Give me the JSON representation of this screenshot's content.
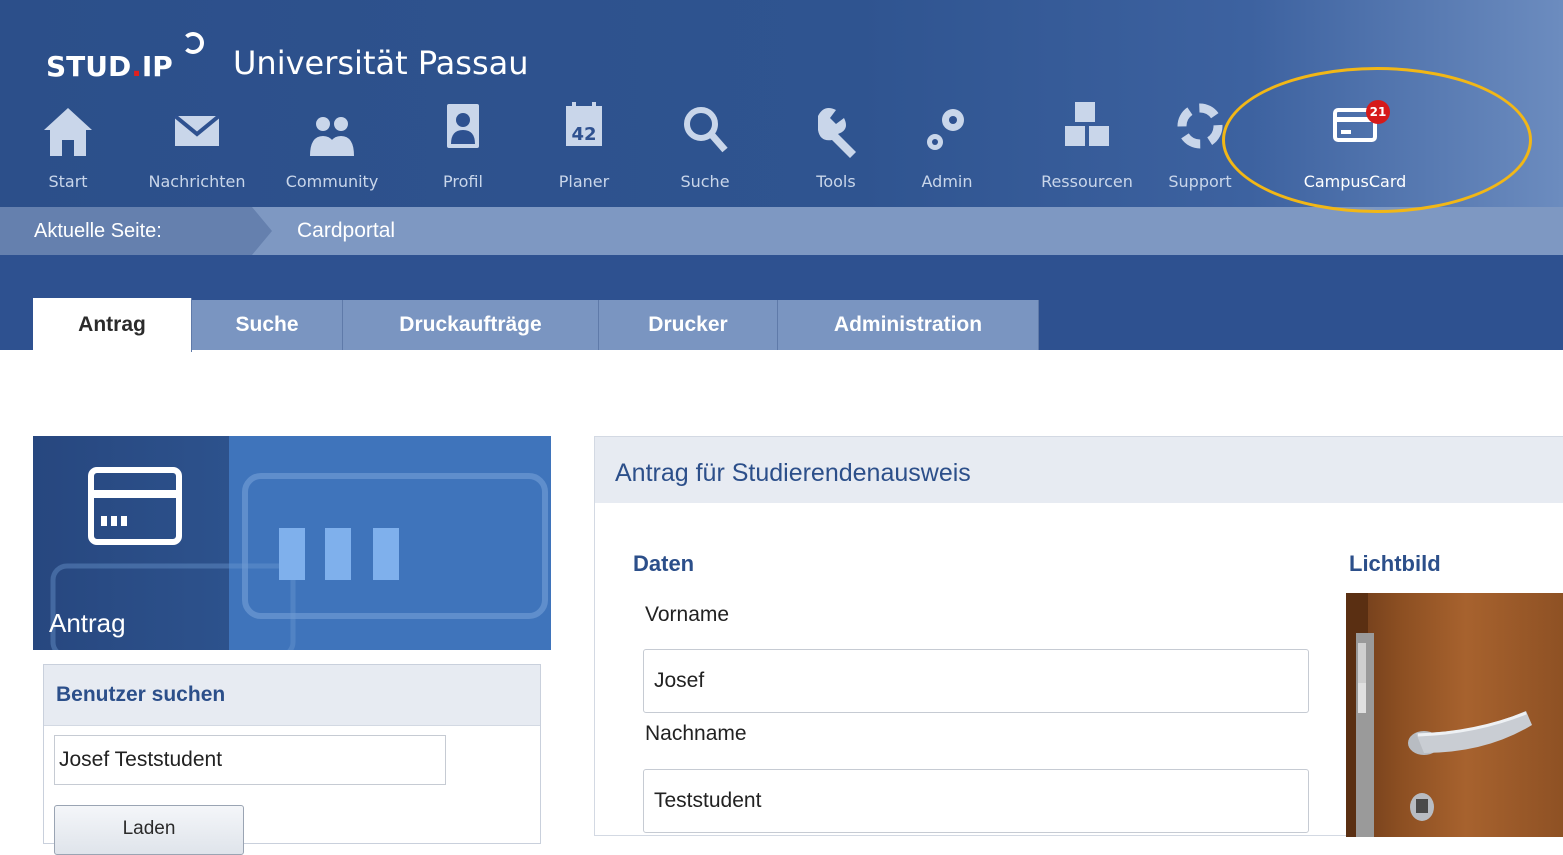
{
  "header": {
    "logo_text_a": "STUD",
    "logo_text_dot": ".",
    "logo_text_b": "IP",
    "institution": "Universität Passau",
    "nav": [
      {
        "label": "Start",
        "icon": "home-icon"
      },
      {
        "label": "Nachrichten",
        "icon": "envelope-icon"
      },
      {
        "label": "Community",
        "icon": "people-icon"
      },
      {
        "label": "Profil",
        "icon": "profile-icon"
      },
      {
        "label": "Planer",
        "icon": "calendar-icon"
      },
      {
        "label": "Suche",
        "icon": "search-icon"
      },
      {
        "label": "Tools",
        "icon": "wrench-icon"
      },
      {
        "label": "Admin",
        "icon": "gears-icon"
      },
      {
        "label": "Ressourcen",
        "icon": "resources-icon"
      },
      {
        "label": "Support",
        "icon": "lifebuoy-icon"
      },
      {
        "label": "CampusCard",
        "icon": "card-icon"
      }
    ],
    "calendar_day": "42",
    "campuscard_badge": "21"
  },
  "breadcrumb": {
    "label": "Aktuelle Seite:",
    "page": "Cardportal"
  },
  "tabs": [
    {
      "label": "Antrag",
      "active": true
    },
    {
      "label": "Suche",
      "active": false
    },
    {
      "label": "Druckaufträge",
      "active": false
    },
    {
      "label": "Drucker",
      "active": false
    },
    {
      "label": "Administration",
      "active": false
    }
  ],
  "sidebar": {
    "title": "Antrag",
    "search_box": {
      "title": "Benutzer suchen",
      "input_value": "Josef Teststudent",
      "button_label": "Laden"
    }
  },
  "main": {
    "title": "Antrag für Studierendenausweis",
    "data_section": "Daten",
    "photo_section": "Lichtbild",
    "fields": [
      {
        "label": "Vorname",
        "value": "Josef"
      },
      {
        "label": "Nachname",
        "value": "Teststudent"
      }
    ]
  },
  "colors": {
    "header_blue": "#2c4f8a",
    "badge_red": "#d61a1a",
    "highlight_yellow": "#f2b716",
    "tab_inactive": "#7a95c1"
  }
}
